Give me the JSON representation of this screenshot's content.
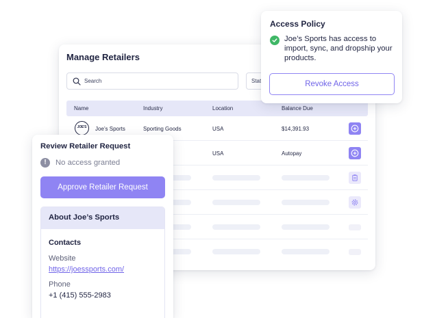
{
  "manage": {
    "title": "Manage Retailers",
    "search_placeholder": "Search",
    "status_filter": "Stat",
    "columns": [
      "Name",
      "Industry",
      "Location",
      "Balance Due"
    ],
    "rows": [
      {
        "logo_text": "JOE'S",
        "name": "Joe’s Sports",
        "industry": "Sporting Goods",
        "location": "USA",
        "balance": "$14,391.93",
        "action_icon": "plus-circle-icon"
      },
      {
        "name": "",
        "industry": "",
        "location": "USA",
        "balance": "Autopay",
        "action_icon": "plus-circle-icon"
      }
    ]
  },
  "policy": {
    "title": "Access Policy",
    "message": "Joe’s Sports has access to import, sync, and dropship your products.",
    "revoke_label": "Revoke Access"
  },
  "review": {
    "title": "Review Retailer Request",
    "status": "No access granted",
    "approve_label": "Approve Retailer Request",
    "about_title": "About Joe’s Sports",
    "contacts_heading": "Contacts",
    "website_label": "Website",
    "website_value": "https://joessports.com/",
    "phone_label": "Phone",
    "phone_value": "+1 (415) 555-2983"
  },
  "colors": {
    "accent": "#8f84f3",
    "accent_text": "#6f63e8",
    "header_bg": "#e6e7f8",
    "success": "#3fb766",
    "muted_icon": "#8d8fa3"
  }
}
